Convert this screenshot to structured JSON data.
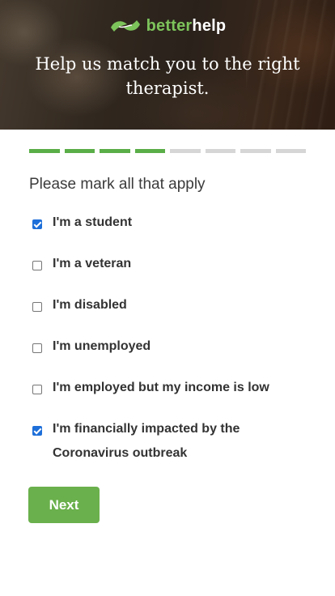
{
  "brand": {
    "name_part1": "better",
    "name_part2": "help",
    "color": "#7dc35b"
  },
  "hero": {
    "title": "Help us match you to the right therapist."
  },
  "progress": {
    "total_steps": 8,
    "completed_steps": 4,
    "done_color": "#5aae48",
    "todo_color": "#d6d6d6"
  },
  "question": {
    "text": "Please mark all that apply"
  },
  "options": [
    {
      "label": "I'm a student",
      "checked": true
    },
    {
      "label": "I'm a veteran",
      "checked": false
    },
    {
      "label": "I'm disabled",
      "checked": false
    },
    {
      "label": "I'm unemployed",
      "checked": false
    },
    {
      "label": "I'm employed but my income is low",
      "checked": false
    },
    {
      "label": "I'm financially impacted by the Coronavirus outbreak",
      "checked": true
    }
  ],
  "actions": {
    "next_label": "Next",
    "button_color": "#6ab04c"
  },
  "icons": {
    "logo": "betterhelp-leaf-logo-icon",
    "checkbox_checked": "checkmark-icon"
  }
}
